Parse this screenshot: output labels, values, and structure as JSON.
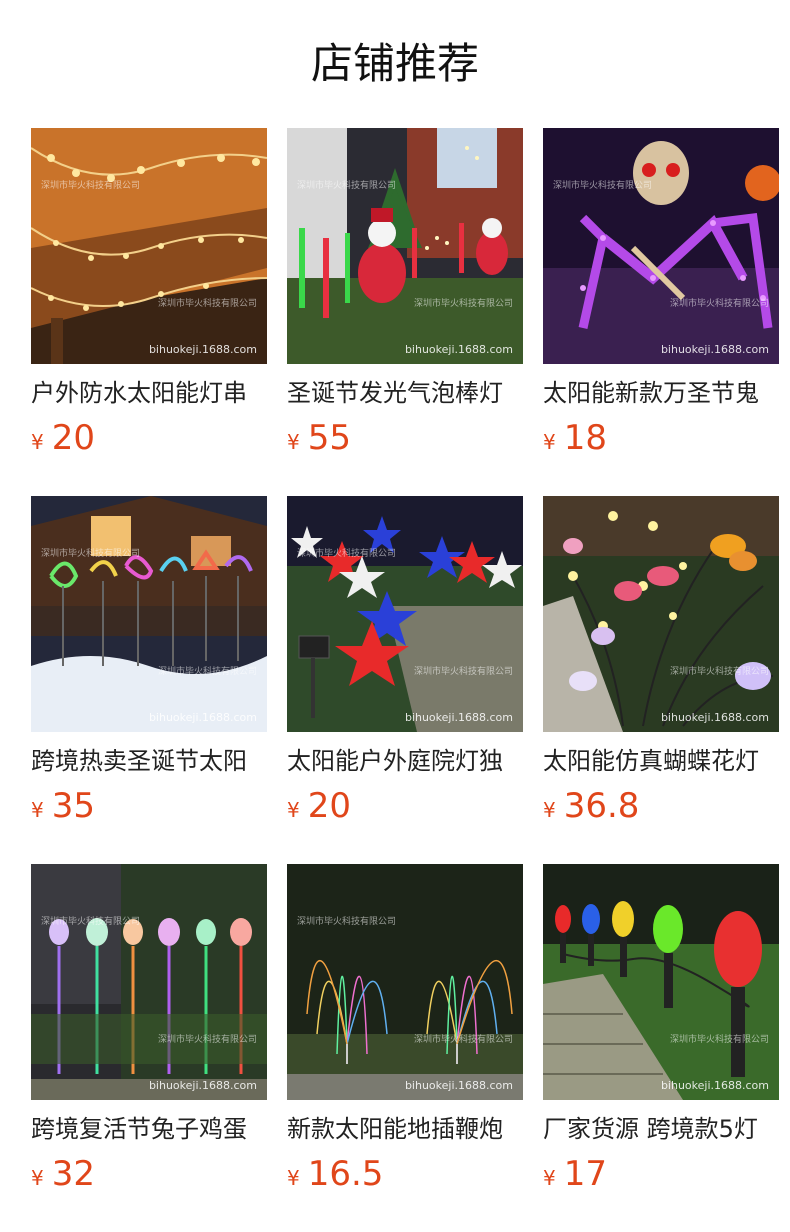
{
  "section_title": "店铺推荐",
  "watermark": "深圳市毕火科技有限公司",
  "image_url_mark": "bihuokeji.1688.com",
  "currency": "¥",
  "colors": {
    "price": "#e0461a"
  },
  "products": [
    {
      "name": "户外防水太阳能灯串",
      "price": "20"
    },
    {
      "name": "圣诞节发光气泡棒灯",
      "price": "55"
    },
    {
      "name": "太阳能新款万圣节鬼",
      "price": "18"
    },
    {
      "name": "跨境热卖圣诞节太阳",
      "price": "35"
    },
    {
      "name": "太阳能户外庭院灯独",
      "price": "20"
    },
    {
      "name": "太阳能仿真蝴蝶花灯",
      "price": "36.8"
    },
    {
      "name": "跨境复活节兔子鸡蛋",
      "price": "32"
    },
    {
      "name": "新款太阳能地插鞭炮",
      "price": "16.5"
    },
    {
      "name": "厂家货源 跨境款5灯",
      "price": "17"
    }
  ]
}
